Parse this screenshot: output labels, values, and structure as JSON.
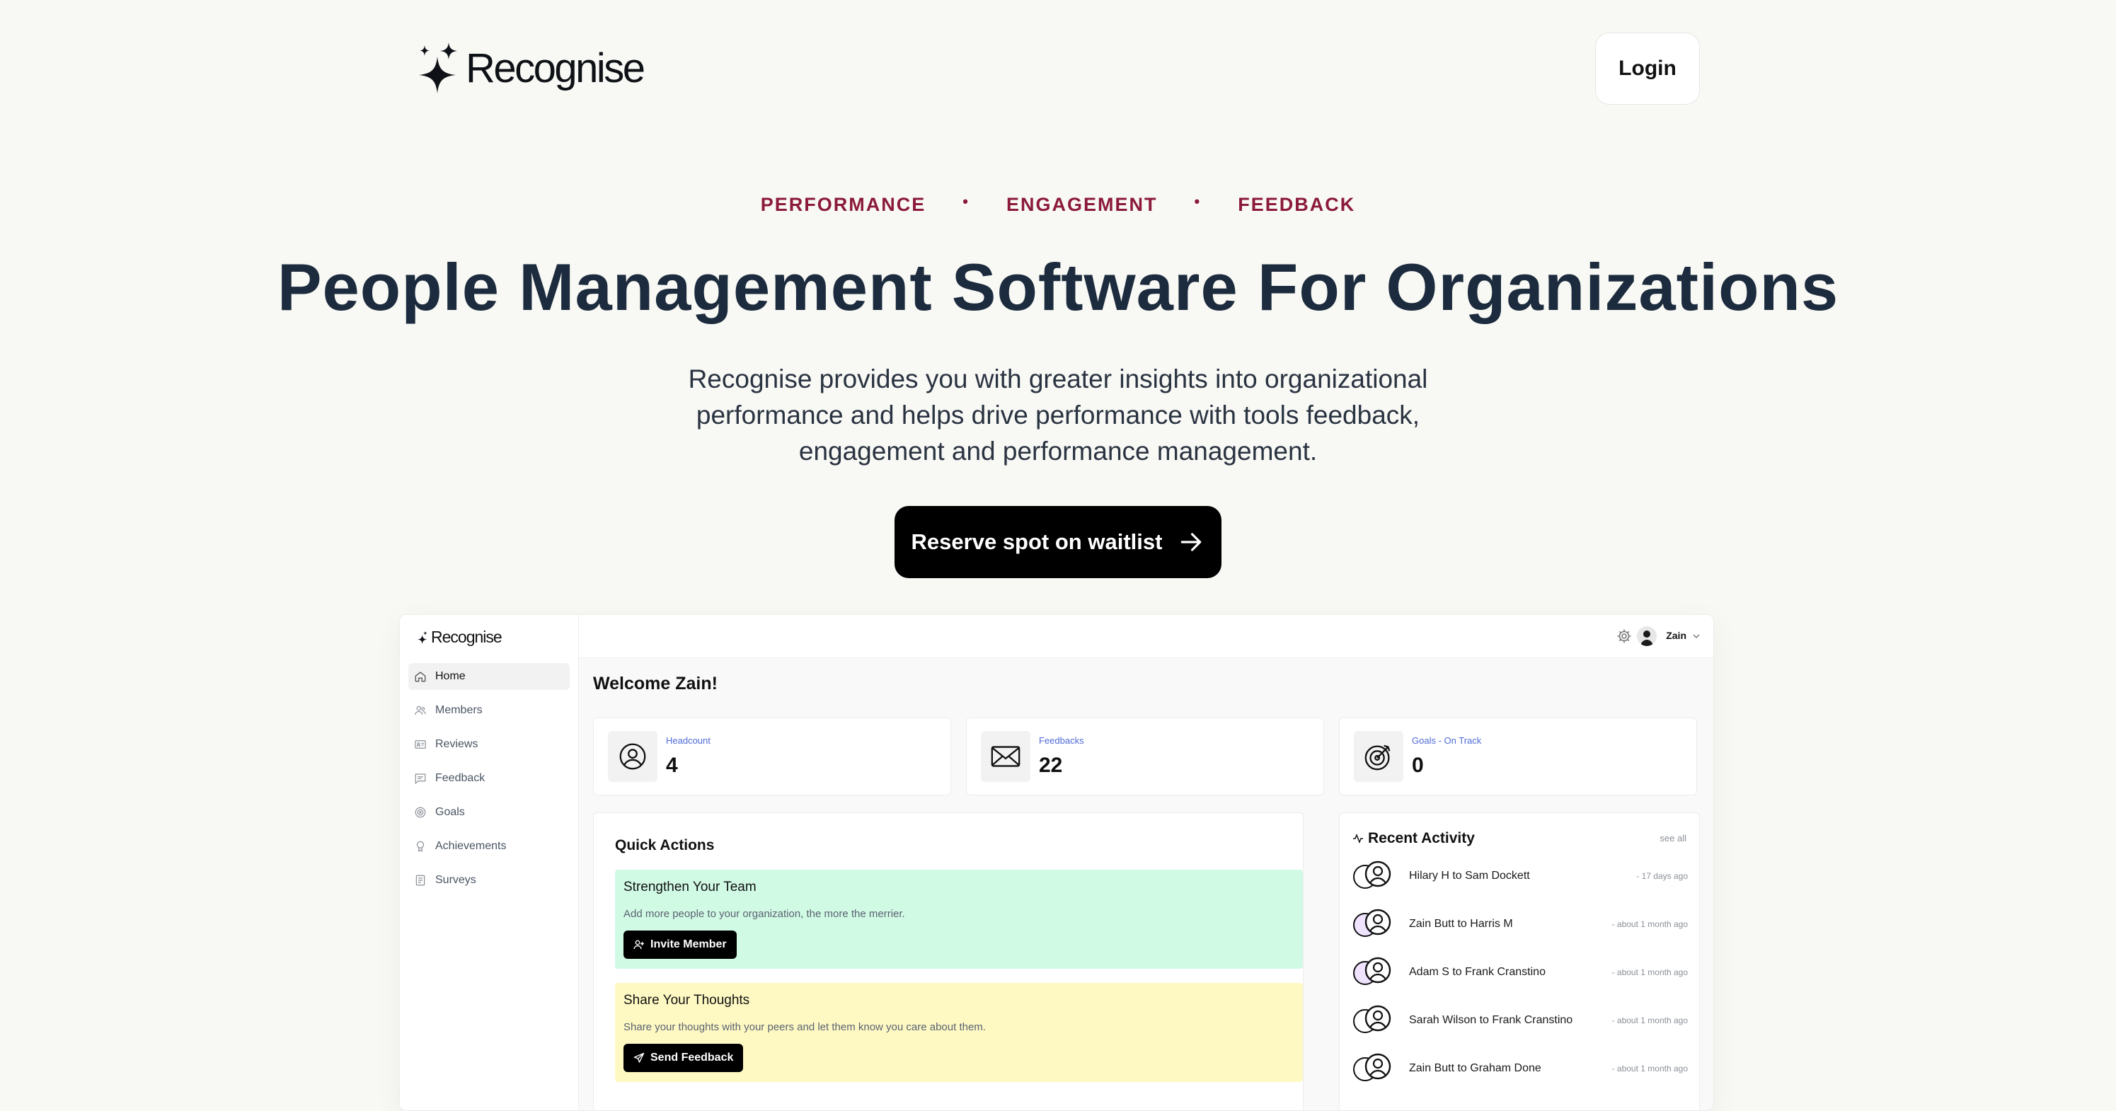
{
  "header": {
    "brand": "Recognise",
    "login_label": "Login"
  },
  "hero": {
    "tags": [
      "PERFORMANCE",
      "ENGAGEMENT",
      "FEEDBACK"
    ],
    "separator": "•",
    "title": "People Management Software For Organizations",
    "subtitle": "Recognise provides you with greater insights into organizational performance and helps drive performance with tools feedback, engagement and performance management.",
    "cta_label": "Reserve spot on waitlist"
  },
  "app": {
    "brand": "Recognise",
    "sidebar": {
      "items": [
        {
          "label": "Home",
          "icon": "home-icon"
        },
        {
          "label": "Members",
          "icon": "users-icon"
        },
        {
          "label": "Reviews",
          "icon": "id-card-icon"
        },
        {
          "label": "Feedback",
          "icon": "message-icon"
        },
        {
          "label": "Goals",
          "icon": "target-icon"
        },
        {
          "label": "Achievements",
          "icon": "award-icon"
        },
        {
          "label": "Surveys",
          "icon": "clipboard-icon"
        }
      ]
    },
    "topbar": {
      "user_name": "Zain"
    },
    "welcome": "Welcome Zain!",
    "stats": [
      {
        "label": "Headcount",
        "value": "4",
        "icon": "user-circle-icon"
      },
      {
        "label": "Feedbacks",
        "value": "22",
        "icon": "envelope-icon"
      },
      {
        "label": "Goals - On Track",
        "value": "0",
        "icon": "target-icon"
      }
    ],
    "quick_actions": {
      "title": "Quick Actions",
      "cards": [
        {
          "title": "Strengthen Your Team",
          "desc": "Add more people to your organization, the more the merrier.",
          "button": "Invite Member",
          "color": "#d1fae5"
        },
        {
          "title": "Share Your Thoughts",
          "desc": "Share your thoughts with your peers and let them know you care about them.",
          "button": "Send Feedback",
          "color": "#fef9c3"
        }
      ]
    },
    "recent_activity": {
      "title": "Recent Activity",
      "see_all": "see all",
      "items": [
        {
          "text": "Hilary H to Sam Dockett",
          "time": "- 17 days ago"
        },
        {
          "text": "Zain Butt to Harris M",
          "time": "- about 1 month ago"
        },
        {
          "text": "Adam S to Frank Cranstino",
          "time": "- about 1 month ago"
        },
        {
          "text": "Sarah Wilson to Frank Cranstino",
          "time": "- about 1 month ago"
        },
        {
          "text": "Zain Butt to Graham Done",
          "time": "- about 1 month ago"
        }
      ]
    }
  },
  "colors": {
    "accent_tag": "#8b1a3a",
    "title": "#1c2b3d",
    "stat_label": "#4f6bd6"
  }
}
